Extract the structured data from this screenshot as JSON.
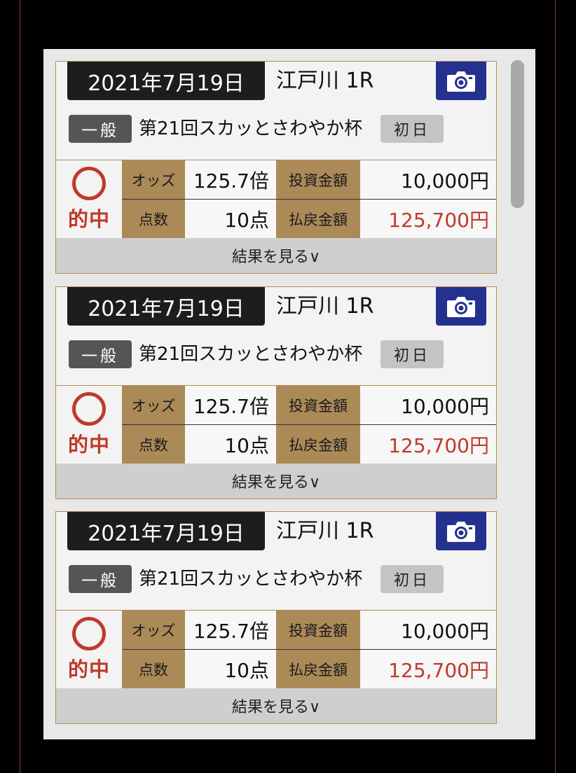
{
  "colors": {
    "accent_red": "#c0392b",
    "label_gold": "#ab8a58",
    "camera_blue": "#25318f"
  },
  "cards": [
    {
      "date": "2021年7月19日",
      "venue": "江戸川 1R",
      "camera_icon": "camera-icon",
      "grade": "一般",
      "race_name": "第21回スカッとさわやか杯",
      "day": "初日",
      "hit_label": "的中",
      "odds_label": "オッズ",
      "odds_value": "125.7倍",
      "invest_label": "投資金額",
      "invest_value": "10,000円",
      "points_label": "点数",
      "points_value": "10点",
      "payout_label": "払戻金額",
      "payout_value": "125,700円",
      "more_label": "結果を見る∨"
    },
    {
      "date": "2021年7月19日",
      "venue": "江戸川 1R",
      "camera_icon": "camera-icon",
      "grade": "一般",
      "race_name": "第21回スカッとさわやか杯",
      "day": "初日",
      "hit_label": "的中",
      "odds_label": "オッズ",
      "odds_value": "125.7倍",
      "invest_label": "投資金額",
      "invest_value": "10,000円",
      "points_label": "点数",
      "points_value": "10点",
      "payout_label": "払戻金額",
      "payout_value": "125,700円",
      "more_label": "結果を見る∨"
    },
    {
      "date": "2021年7月19日",
      "venue": "江戸川 1R",
      "camera_icon": "camera-icon",
      "grade": "一般",
      "race_name": "第21回スカッとさわやか杯",
      "day": "初日",
      "hit_label": "的中",
      "odds_label": "オッズ",
      "odds_value": "125.7倍",
      "invest_label": "投資金額",
      "invest_value": "10,000円",
      "points_label": "点数",
      "points_value": "10点",
      "payout_label": "払戻金額",
      "payout_value": "125,700円",
      "more_label": "結果を見る∨"
    }
  ]
}
